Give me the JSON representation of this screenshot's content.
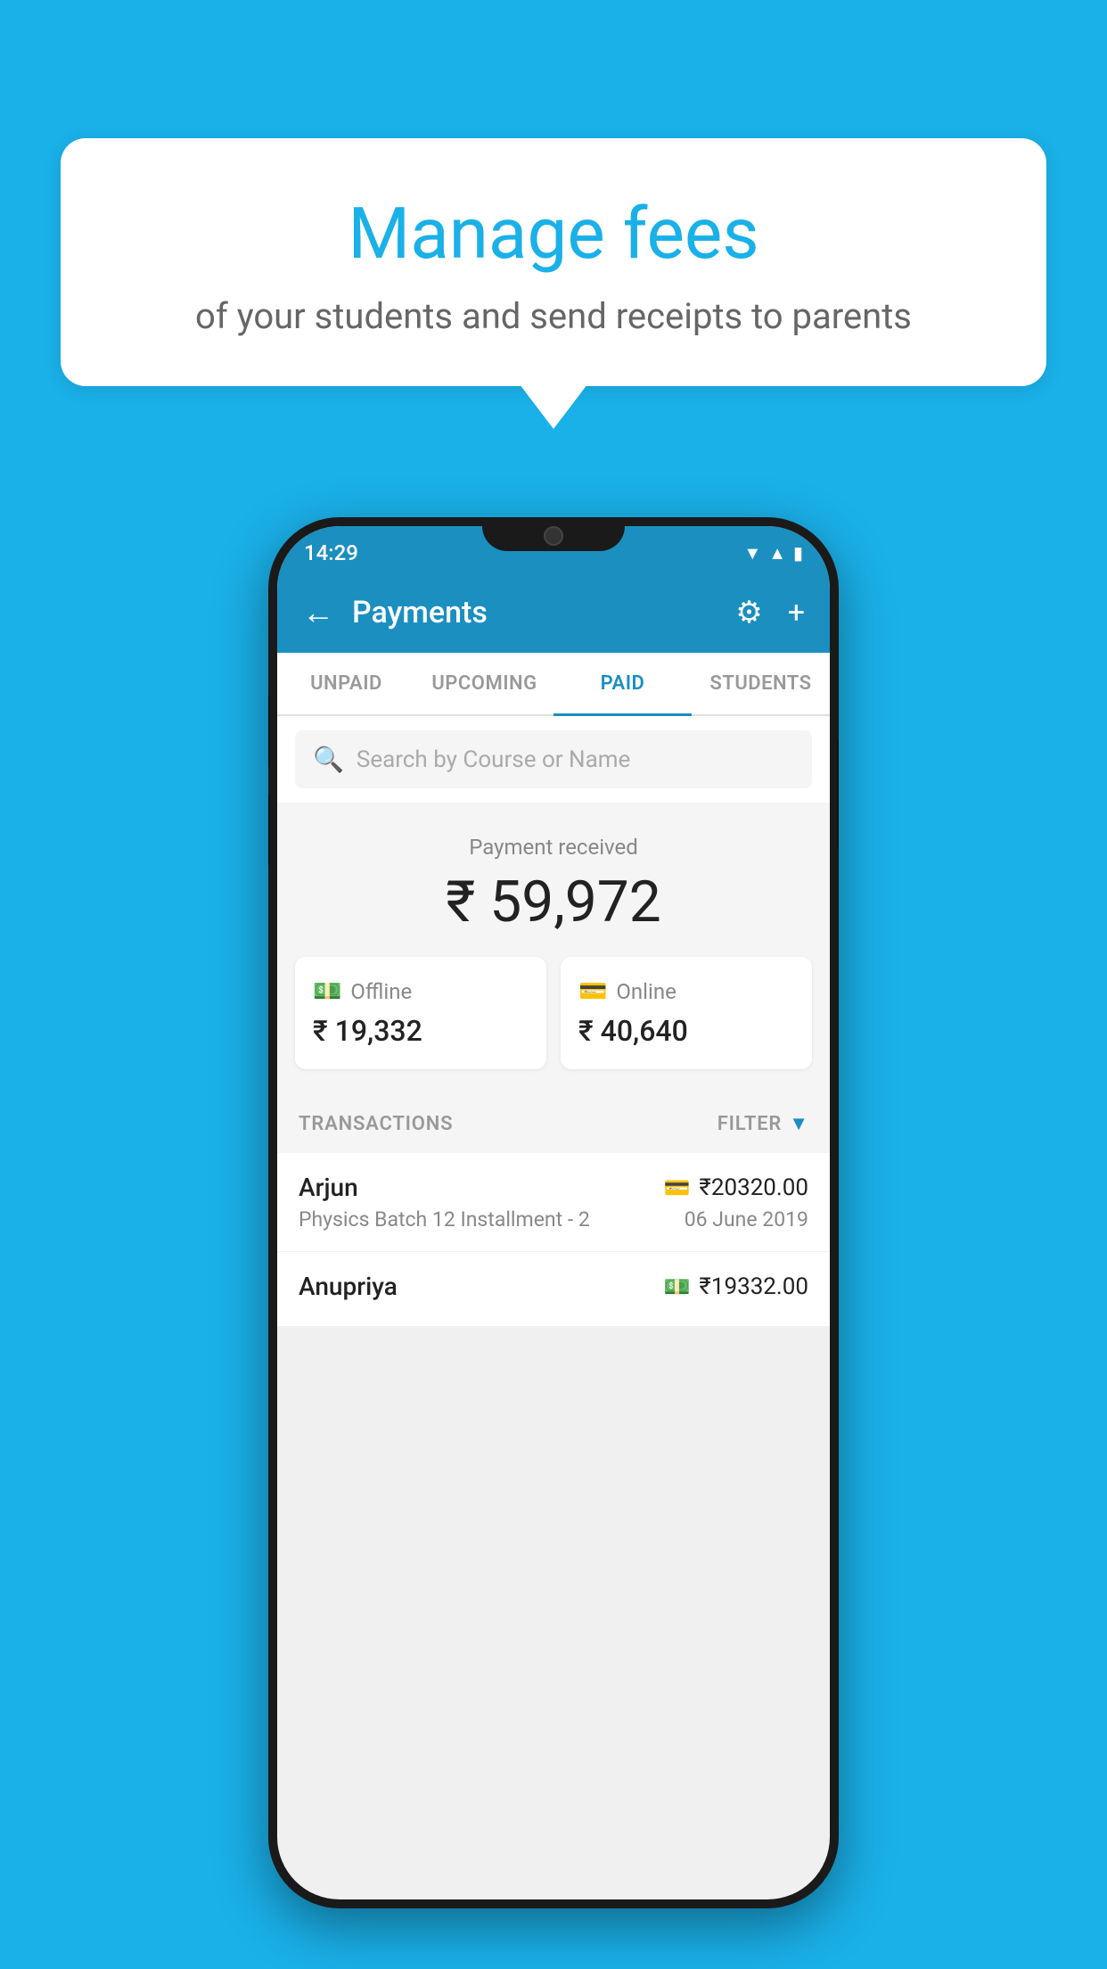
{
  "page": {
    "background_color": "#1ab0e8"
  },
  "speech_bubble": {
    "title": "Manage fees",
    "subtitle": "of your students and send receipts to parents"
  },
  "status_bar": {
    "time": "14:29",
    "wifi": "▾",
    "signal": "▲",
    "battery": "▮"
  },
  "app_bar": {
    "title": "Payments",
    "back_icon": "←",
    "gear_icon": "⚙",
    "plus_icon": "+"
  },
  "tabs": [
    {
      "id": "unpaid",
      "label": "UNPAID",
      "active": false
    },
    {
      "id": "upcoming",
      "label": "UPCOMING",
      "active": false
    },
    {
      "id": "paid",
      "label": "PAID",
      "active": true
    },
    {
      "id": "students",
      "label": "STUDENTS",
      "active": false
    }
  ],
  "search": {
    "placeholder": "Search by Course or Name"
  },
  "payment_summary": {
    "label": "Payment received",
    "amount": "₹ 59,972",
    "offline": {
      "label": "Offline",
      "amount": "₹ 19,332"
    },
    "online": {
      "label": "Online",
      "amount": "₹ 40,640"
    }
  },
  "transactions": {
    "header_label": "TRANSACTIONS",
    "filter_label": "FILTER",
    "items": [
      {
        "name": "Arjun",
        "course": "Physics Batch 12 Installment - 2",
        "amount": "₹20320.00",
        "date": "06 June 2019",
        "payment_type": "online"
      },
      {
        "name": "Anupriya",
        "course": "",
        "amount": "₹19332.00",
        "date": "",
        "payment_type": "offline"
      }
    ]
  }
}
